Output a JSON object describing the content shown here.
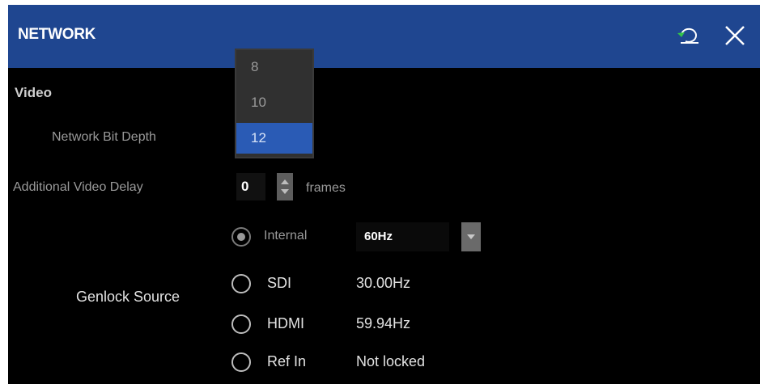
{
  "header": {
    "title": "NETWORK",
    "reset_icon": "reset-icon",
    "close_icon": "close-icon",
    "bg_color": "#1f4690"
  },
  "video": {
    "section_title": "Video",
    "bit_depth_label": "Network Bit Depth",
    "bit_depth_options": [
      "8",
      "10",
      "12"
    ],
    "bit_depth_selected": "12",
    "delay_label": "Additional Video Delay",
    "delay_value": "0",
    "delay_unit": "frames"
  },
  "genlock": {
    "label": "Genlock Source",
    "options": [
      {
        "name": "Internal",
        "value": "60Hz",
        "selected": true
      },
      {
        "name": "SDI",
        "value": "30.00Hz",
        "selected": false
      },
      {
        "name": "HDMI",
        "value": "59.94Hz",
        "selected": false
      },
      {
        "name": "Ref In",
        "value": "Not locked",
        "selected": false
      }
    ]
  },
  "colors": {
    "accent": "#2a5bb5",
    "reset_icon": "#33c24a"
  }
}
